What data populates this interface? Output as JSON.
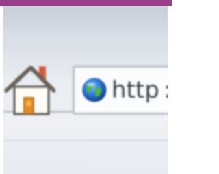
{
  "theme": {
    "accent_bar_color": "#9a3d8c"
  },
  "toolbar": {
    "home_button": {
      "icon": "home-icon"
    },
    "address_bar": {
      "favicon": "globe-icon",
      "url_text": "http",
      "url_separator": ":"
    }
  }
}
